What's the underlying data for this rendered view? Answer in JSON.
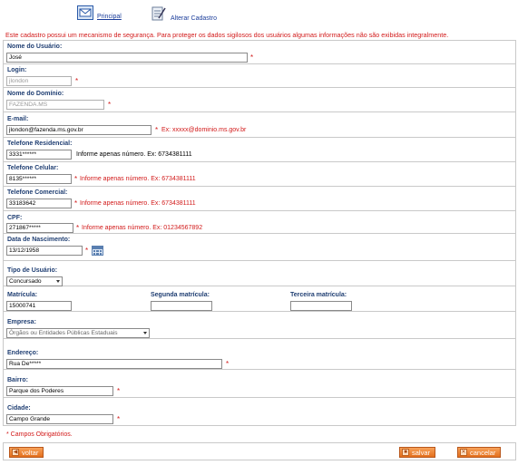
{
  "nav": {
    "principal_label": "Principal",
    "alterar_label": "Alterar Cadastro"
  },
  "notice": "Este cadastro possui um mecanismo de segurança. Para proteger os dados sigilosos dos usuários algumas informações não são exibidas integralmente.",
  "fields": {
    "nome": {
      "label": "Nome do Usuário:",
      "value": "José"
    },
    "login": {
      "label": "Login:",
      "value": "jlondon"
    },
    "dominio": {
      "label": "Nome do Domínio:",
      "value": "FAZENDA.MS"
    },
    "email": {
      "label": "E-mail:",
      "value": "jlondon@fazenda.ms.gov.br",
      "hint": "Ex: xxxxx@dominio.ms.gov.br"
    },
    "tel_res": {
      "label": "Telefone Residencial:",
      "value": "3331******",
      "hint": "Informe apenas número. Ex: 6734381111"
    },
    "tel_cel": {
      "label": "Telefone Celular:",
      "value": "8135******",
      "hint": "Informe apenas número. Ex: 6734381111"
    },
    "tel_com": {
      "label": "Telefone Comercial:",
      "value": "33183642",
      "hint": "Informe apenas número. Ex: 6734381111"
    },
    "cpf": {
      "label": "CPF:",
      "value": "271867*****",
      "hint": "Informe apenas número. Ex: 01234567892"
    },
    "nascimento": {
      "label": "Data de Nascimento:",
      "value": "13/12/1958"
    },
    "tipo": {
      "label": "Tipo de Usuário:",
      "value": "Concursado"
    },
    "matricula": {
      "label": "Matrícula:",
      "value": "15000741"
    },
    "segunda": {
      "label": "Segunda matrícula:",
      "value": ""
    },
    "terceira": {
      "label": "Terceira matrícula:",
      "value": ""
    },
    "empresa": {
      "label": "Empresa:",
      "value": "Órgãos ou Entidades Públicas Estaduais"
    },
    "endereco": {
      "label": "Endereço:",
      "value": "Rua De*****"
    },
    "bairro": {
      "label": "Bairro:",
      "value": "Parque dos Poderes"
    },
    "cidade": {
      "label": "Cidade:",
      "value": "Campo Grande"
    }
  },
  "required_mark": "*",
  "required_note": "* Campos Obrigatórios.",
  "buttons": {
    "voltar": "voltar",
    "salvar": "salvar",
    "cancelar": "cancelar"
  },
  "icons": {
    "principal": "envelope-icon",
    "alterar": "edit-document-icon",
    "calendar": "calendar-icon"
  }
}
